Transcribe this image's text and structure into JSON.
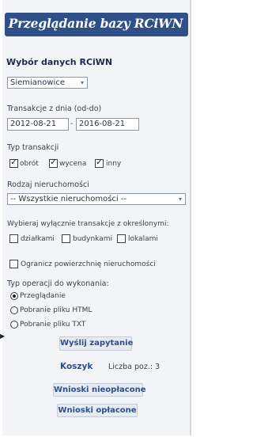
{
  "header": {
    "title": "Przeglądanie bazy RCiWN"
  },
  "form": {
    "section_title": "Wybór danych RCiWN",
    "municipality": {
      "value": "Siemianowice"
    },
    "date_range": {
      "label": "Transakcje z dnia (od-do)",
      "from": "2012-08-21",
      "separator": "-",
      "to": "2016-08-21"
    },
    "transaction_type": {
      "label": "Typ transakcji",
      "options": [
        {
          "label": "obrót",
          "checked": true
        },
        {
          "label": "wycena",
          "checked": true
        },
        {
          "label": "inny",
          "checked": true
        }
      ]
    },
    "property_type": {
      "label": "Rodzaj nieruchomości",
      "value": "-- Wszystkie nieruchomości --"
    },
    "exclusive": {
      "label": "Wybieraj wyłącznie transakcje z określonymi:",
      "options": [
        {
          "label": "działkami",
          "checked": false
        },
        {
          "label": "budynkami",
          "checked": false
        },
        {
          "label": "lokalami",
          "checked": false
        }
      ]
    },
    "limit_area": {
      "label": "Ogranicz powierzchnię nieruchomości",
      "checked": false
    },
    "operation": {
      "label": "Typ operacji do wykonania:",
      "options": [
        {
          "label": "Przeglądanie",
          "selected": true
        },
        {
          "label": "Pobranie pliku HTML",
          "selected": false
        },
        {
          "label": "Pobranie pliku TXT",
          "selected": false
        }
      ]
    },
    "submit_label": "Wyślij zapytanie"
  },
  "basket": {
    "label": "Koszyk",
    "count_label": "Liczba poz.: 3"
  },
  "applications": {
    "unpaid_label": "Wnioski nieopłacone",
    "paid_label": "Wnioski opłacone"
  },
  "icons": {
    "dropdown": "chevron-down-icon",
    "check": "check-icon"
  }
}
